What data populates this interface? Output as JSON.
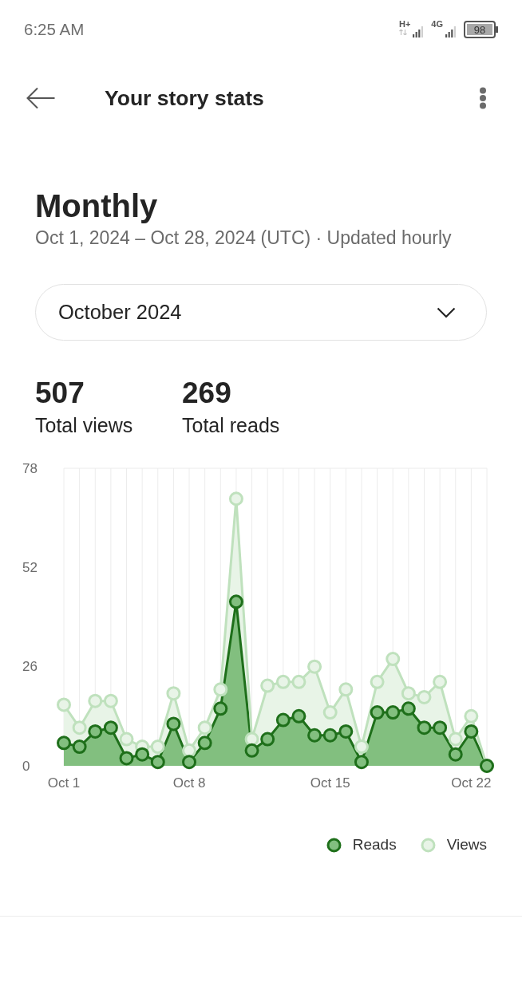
{
  "status_bar": {
    "time": "6:25 AM",
    "networks": [
      {
        "label": "H+",
        "data_activity": true
      },
      {
        "label": "4G",
        "data_activity": false
      }
    ],
    "battery": "98"
  },
  "header": {
    "title": "Your story stats"
  },
  "period": {
    "title": "Monthly",
    "range": "Oct 1, 2024 – Oct 28, 2024 (UTC) · Updated hourly"
  },
  "month_select": {
    "value": "October 2024"
  },
  "totals": [
    {
      "value": "507",
      "label": "Total views"
    },
    {
      "value": "269",
      "label": "Total reads"
    }
  ],
  "stats_chart": {
    "chart_data": {
      "type": "area",
      "grid": true,
      "categories": [
        "Oct 1",
        null,
        null,
        null,
        null,
        null,
        null,
        null,
        "Oct 8",
        null,
        null,
        null,
        null,
        null,
        null,
        null,
        null,
        "Oct 15",
        null,
        null,
        null,
        null,
        null,
        null,
        null,
        null,
        "Oct 22",
        null
      ],
      "ylim": [
        0,
        78
      ],
      "yticks": [
        0,
        26,
        52,
        78
      ],
      "series": [
        {
          "name": "Reads",
          "color": "#82bf7f",
          "values": [
            6,
            5,
            9,
            10,
            2,
            3,
            1,
            11,
            1,
            6,
            15,
            43,
            4,
            7,
            12,
            13,
            8,
            8,
            9,
            1,
            14,
            14,
            15,
            10,
            10,
            3,
            9,
            0
          ]
        },
        {
          "name": "Views",
          "color": "#e8f4e7",
          "values": [
            16,
            10,
            17,
            17,
            7,
            5,
            5,
            19,
            4,
            10,
            20,
            70,
            7,
            21,
            22,
            22,
            26,
            14,
            20,
            5,
            22,
            28,
            19,
            18,
            22,
            7,
            13,
            0
          ]
        }
      ]
    }
  }
}
